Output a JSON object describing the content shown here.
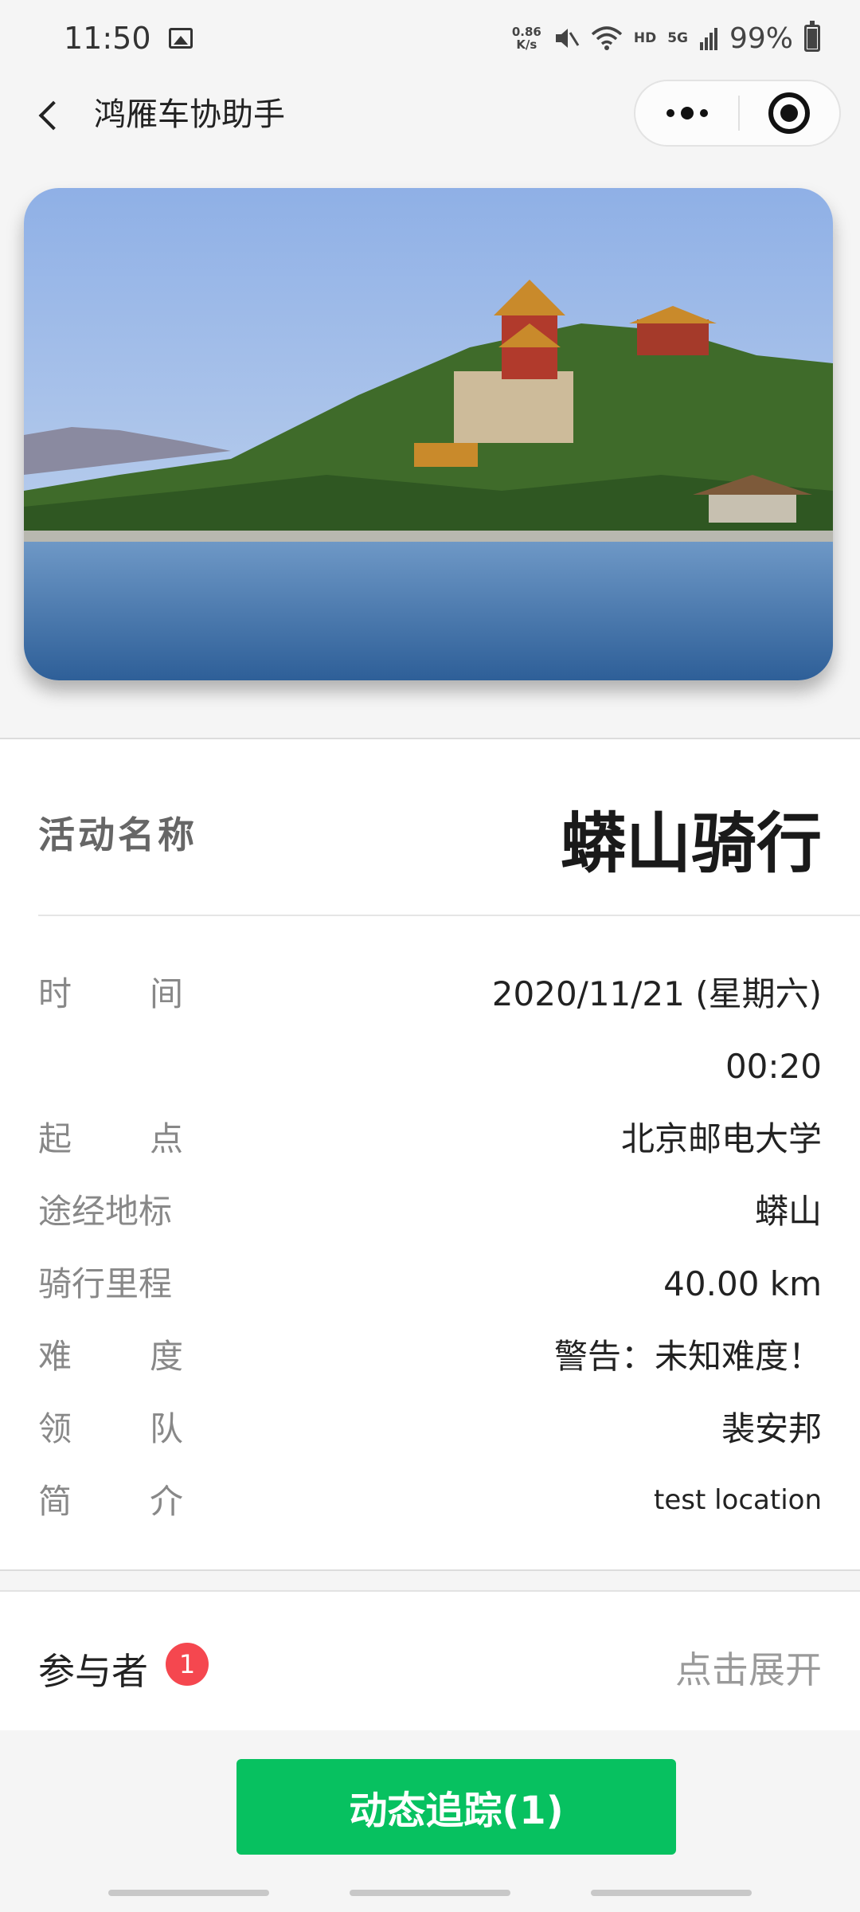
{
  "status_bar": {
    "time": "11:50",
    "net_speed_value": "0.86",
    "net_speed_unit": "K/s",
    "hd_label": "HD",
    "network_label": "5G",
    "battery_text": "99%"
  },
  "nav": {
    "title": "鸿雁车协助手"
  },
  "activity": {
    "name_label": "活动名称",
    "name_value": "蟒山骑行",
    "details": [
      {
        "label_chars": [
          "时",
          "间"
        ],
        "value": "2020/11/21 (星期六)"
      },
      {
        "label_chars": [],
        "value": "00:20"
      },
      {
        "label_chars": [
          "起",
          "点"
        ],
        "value": "北京邮电大学"
      },
      {
        "label_chars": [
          "途经地标"
        ],
        "value": "蟒山"
      },
      {
        "label_chars": [
          "骑行里程"
        ],
        "value": "40.00 km"
      },
      {
        "label_chars": [
          "难",
          "度"
        ],
        "value": "警告：未知难度！"
      },
      {
        "label_chars": [
          "领",
          "队"
        ],
        "value": "裴安邦"
      },
      {
        "label_chars": [
          "简",
          "介"
        ],
        "value": "test location"
      }
    ]
  },
  "participants": {
    "label": "参与者",
    "count_badge": "1",
    "expand_label": "点击展开"
  },
  "bottom": {
    "track_button_label": "动态追踪(1)"
  },
  "colors": {
    "accent_green": "#07c160",
    "badge_red": "#f5474f"
  }
}
